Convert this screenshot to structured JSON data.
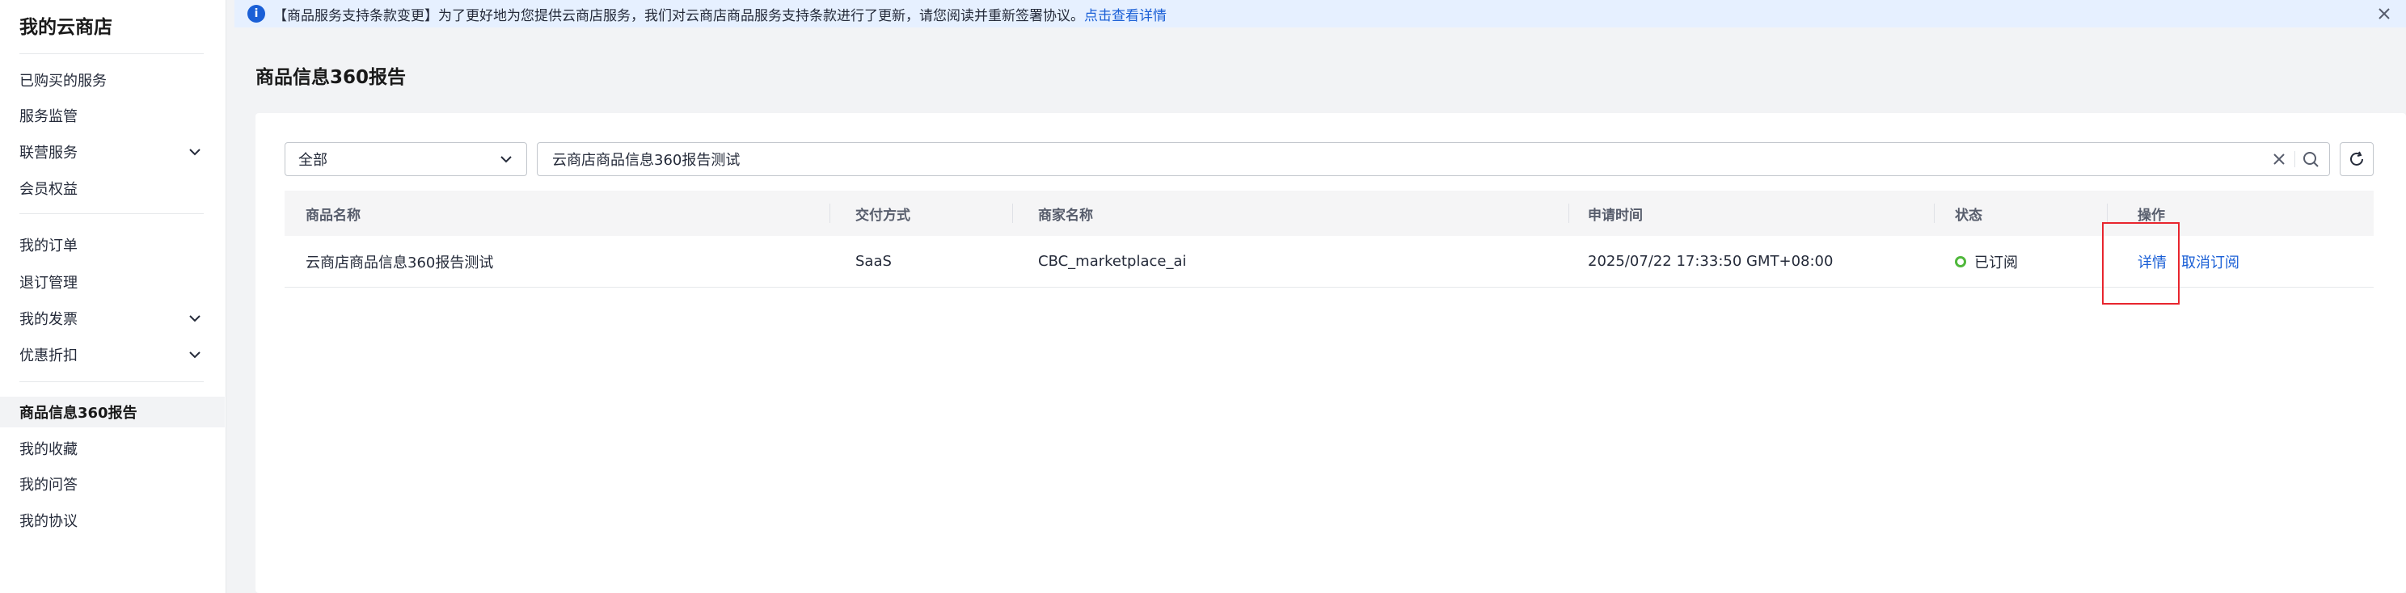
{
  "sidebar": {
    "title": "我的云商店",
    "items": [
      {
        "label": "已购买的服务"
      },
      {
        "label": "服务监管"
      },
      {
        "label": "联营服务"
      },
      {
        "label": "会员权益"
      },
      {
        "label": "我的订单"
      },
      {
        "label": "退订管理"
      },
      {
        "label": "我的发票"
      },
      {
        "label": "优惠折扣"
      },
      {
        "label": "商品信息360报告"
      },
      {
        "label": "我的收藏"
      },
      {
        "label": "我的问答"
      },
      {
        "label": "我的协议"
      }
    ]
  },
  "notice": {
    "text": "【商品服务支持条款变更】为了更好地为您提供云商店服务，我们对云商店商品服务支持条款进行了更新，请您阅读并重新签署协议。",
    "link": "点击查看详情"
  },
  "page": {
    "title": "商品信息360报告"
  },
  "filter": {
    "select_value": "全部",
    "search_value": "云商店商品信息360报告测试"
  },
  "table": {
    "headers": [
      "商品名称",
      "交付方式",
      "商家名称",
      "申请时间",
      "状态",
      "操作"
    ],
    "rows": [
      {
        "name": "云商店商品信息360报告测试",
        "delivery": "SaaS",
        "merchant": "CBC_marketplace_ai",
        "time": "2025/07/22 17:33:50 GMT+08:00",
        "status": "已订阅",
        "action_detail": "详情",
        "action_unsubscribe": "取消订阅"
      }
    ]
  },
  "colors": {
    "accent": "#1a5fd6",
    "status_ok": "#50b83c",
    "highlight": "#e8252e"
  }
}
